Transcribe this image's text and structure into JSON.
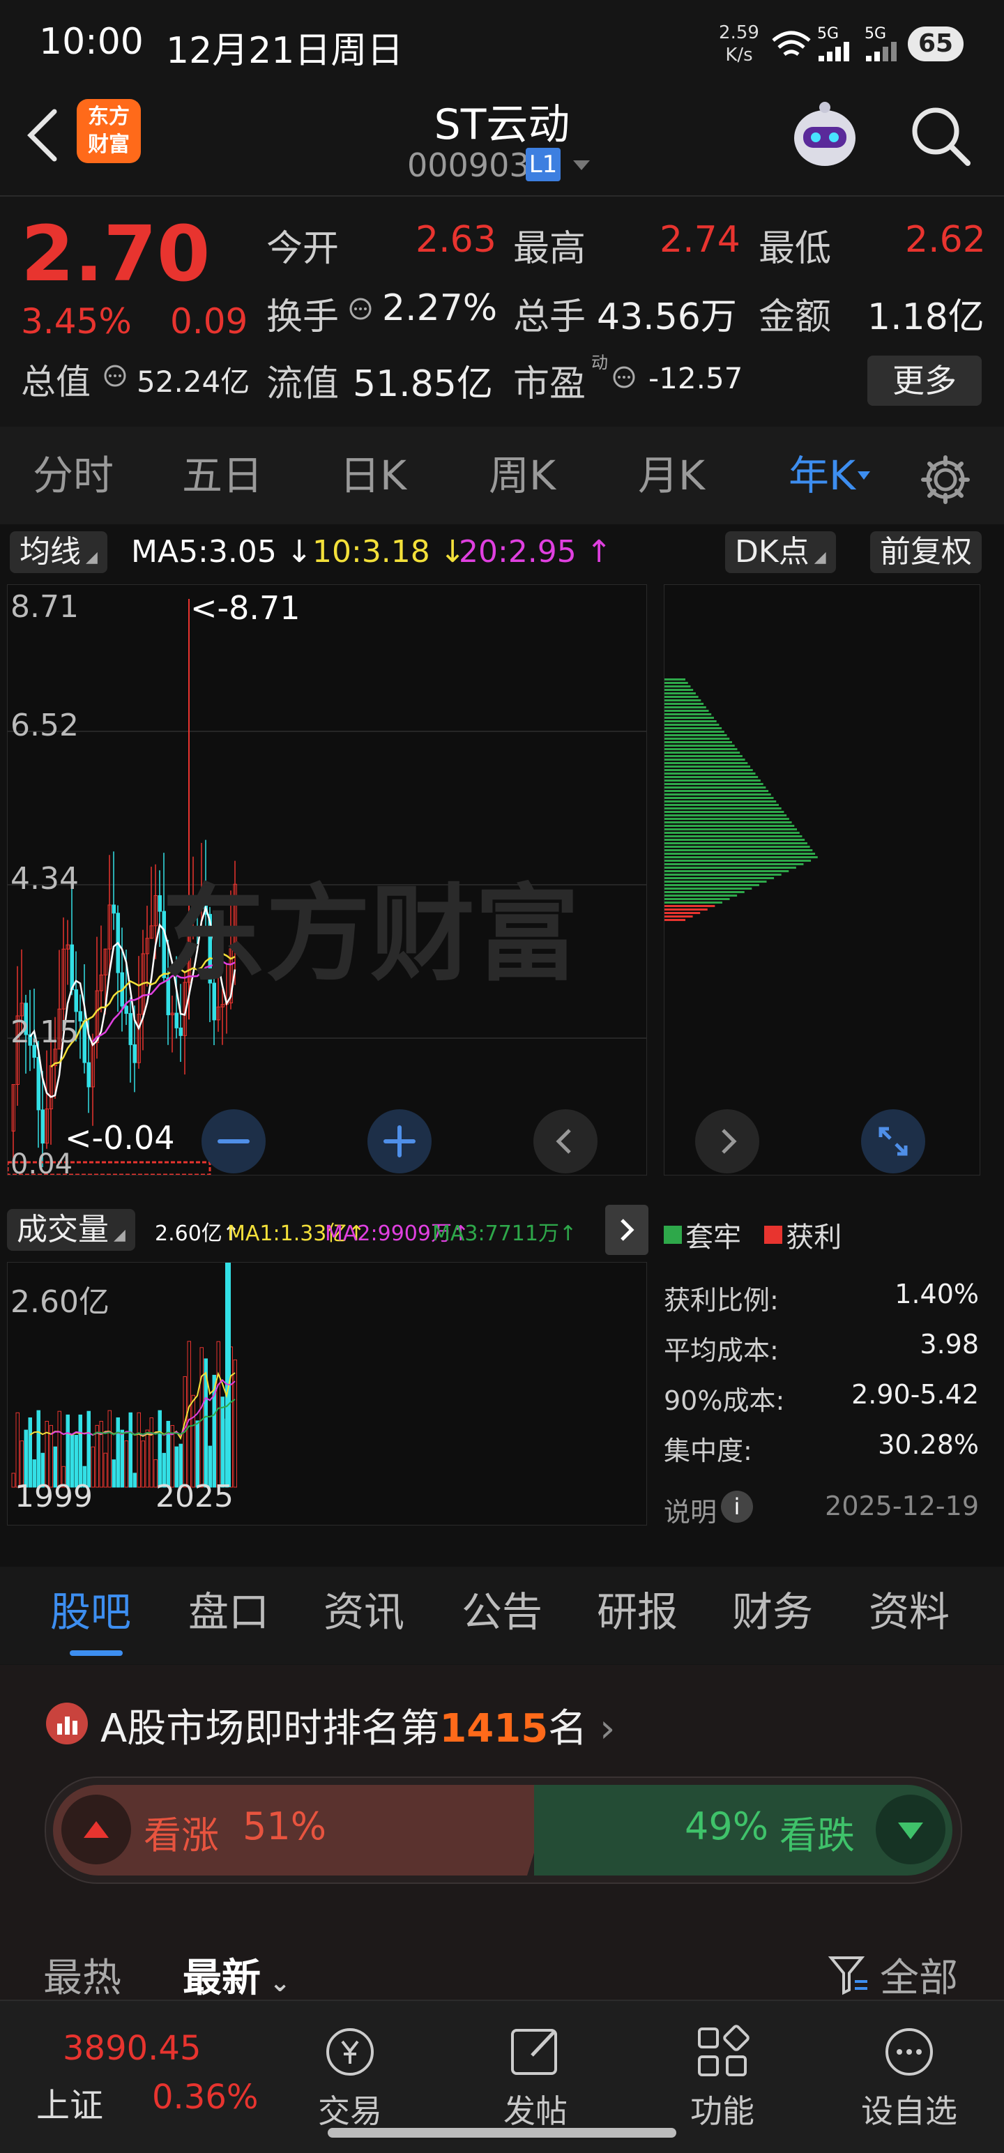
{
  "status_bar": {
    "time": "10:00",
    "date": "12月21日周日",
    "net_speed_value": "2.59",
    "net_speed_unit": "K/s",
    "signal1": "5G",
    "signal2": "5G",
    "battery": "65"
  },
  "nav": {
    "brand_line1": "东方",
    "brand_line2": "财富",
    "stock_name": "ST云动",
    "stock_code": "000903",
    "level_badge": "L1"
  },
  "quote": {
    "price": "2.70",
    "change_pct": "3.45%",
    "change_abs": "0.09",
    "total_value_label": "总值",
    "total_value": "52.24亿",
    "open_label": "今开",
    "open": "2.63",
    "high_label": "最高",
    "high": "2.74",
    "low_label": "最低",
    "low": "2.62",
    "turnover_label": "换手",
    "turnover": "2.27%",
    "volume_label": "总手",
    "volume": "43.56万",
    "amount_label": "金额",
    "amount": "1.18亿",
    "float_label": "流值",
    "float": "51.85亿",
    "pe_label": "市盈",
    "pe_sup": "动",
    "pe": "-12.57",
    "more_label": "更多"
  },
  "period_tabs": [
    "分时",
    "五日",
    "日K",
    "周K",
    "月K",
    "年K"
  ],
  "active_period": "年K",
  "chart_toolbar": {
    "indicator": "均线",
    "ma5": "MA5:3.05",
    "ma10": "10:3.18",
    "ma20": "20:2.95",
    "dk_label": "DK点",
    "fq_label": "前复权"
  },
  "chart_labels": {
    "watermark": "东方财富",
    "max_marker": "<-8.71",
    "min_marker": "<-0.04",
    "volume_indicator": "成交量",
    "vol_value": "2.60亿",
    "vma1": "MA1:1.33亿",
    "vma2": "MA2:9909万",
    "vma3": "MA3:7711万",
    "vol_axis_top": "2.60亿",
    "start_year": "1999",
    "end_year": "2025"
  },
  "chips": {
    "legend_trapped": "套牢",
    "legend_profit": "获利",
    "rows": [
      {
        "label": "获利比例:",
        "value": "1.40%"
      },
      {
        "label": "平均成本:",
        "value": "3.98"
      },
      {
        "label": "90%成本:",
        "value": "2.90-5.42"
      },
      {
        "label": "集中度:",
        "value": "30.28%"
      }
    ],
    "note_label": "说明",
    "date": "2025-12-19"
  },
  "sub_tabs": [
    "股吧",
    "盘口",
    "资讯",
    "公告",
    "研报",
    "财务",
    "资料"
  ],
  "active_sub_tab": "股吧",
  "forum": {
    "rank_prefix": "A股市场即时排名第",
    "rank_number": "1415",
    "rank_suffix": "名",
    "bull_label": "看涨",
    "bull_pct": "51%",
    "bear_label": "看跌",
    "bear_pct": "49%",
    "sort_hot": "最热",
    "sort_new": "最新",
    "filter_label": "全部"
  },
  "bottom_nav": {
    "index_value": "3890.45",
    "index_name": "上证",
    "index_change": "0.36%",
    "items": [
      "交易",
      "发帖",
      "功能",
      "设自选"
    ]
  },
  "colors": {
    "up": "#e8342f",
    "down": "#2ea84a",
    "cyan_candle": "#33e0e6",
    "accent_blue": "#3d8ef0",
    "ma_white": "#ffffff",
    "ma_yellow": "#f3e03a",
    "ma_magenta": "#e040e0"
  },
  "chart_data": {
    "type": "candlestick",
    "title": "",
    "period": "年K",
    "x_categories": [
      "1999",
      "2025"
    ],
    "y_ticks": [
      8.71,
      6.52,
      4.34,
      2.15,
      0.04
    ],
    "ylim": [
      0.04,
      8.71
    ],
    "y_max_label": 8.71,
    "y_min_label": 0.04,
    "series": [
      {
        "name": "MA5",
        "last": 3.05
      },
      {
        "name": "MA10",
        "last": 3.18
      },
      {
        "name": "MA20",
        "last": 2.95
      }
    ],
    "volume": {
      "ymax": "2.60亿",
      "last": "2.60亿",
      "ma": [
        {
          "name": "MA1",
          "value": "1.33亿"
        },
        {
          "name": "MA2",
          "value": "9909万"
        },
        {
          "name": "MA3",
          "value": "7711万"
        }
      ]
    },
    "chip_distribution": {
      "profit_ratio": "1.40%",
      "avg_cost": 3.98,
      "cost_90pct": "2.90-5.42",
      "concentration": "30.28%"
    },
    "grid": true
  }
}
